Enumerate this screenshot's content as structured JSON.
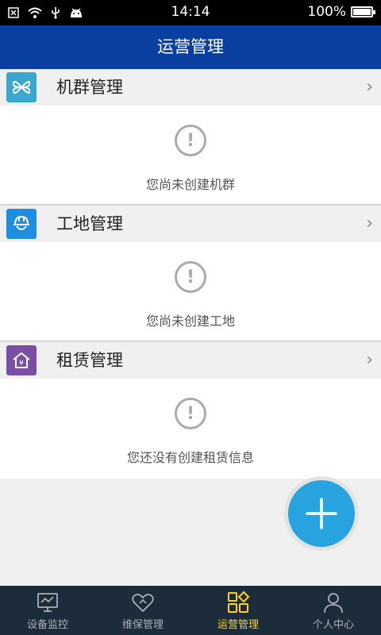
{
  "status": {
    "time": "14:14",
    "battery": "100%",
    "battery_level": 1.0
  },
  "header": {
    "title": "运营管理"
  },
  "sections": [
    {
      "title": "机群管理",
      "empty_text": "您尚未创建机群",
      "icon": "cluster-icon",
      "icon_color": "#3aa7d0"
    },
    {
      "title": "工地管理",
      "empty_text": "您尚未创建工地",
      "icon": "helmet-icon",
      "icon_color": "#1e8fe0"
    },
    {
      "title": "租赁管理",
      "empty_text": "您还没有创建租赁信息",
      "icon": "lease-house-icon",
      "icon_color": "#7a4fa3"
    }
  ],
  "fab": {
    "icon": "plus-icon",
    "color": "#27a3e0"
  },
  "bottom_nav": [
    {
      "label": "设备监控",
      "icon": "monitor-icon",
      "active": false
    },
    {
      "label": "维保管理",
      "icon": "heart-icon",
      "active": false
    },
    {
      "label": "运营管理",
      "icon": "grid-icon",
      "active": true
    },
    {
      "label": "个人中心",
      "icon": "person-icon",
      "active": false
    }
  ],
  "colors": {
    "header": "#0a3fa2",
    "nav_bg": "#1d2c3a",
    "nav_active": "#ffd21f"
  }
}
